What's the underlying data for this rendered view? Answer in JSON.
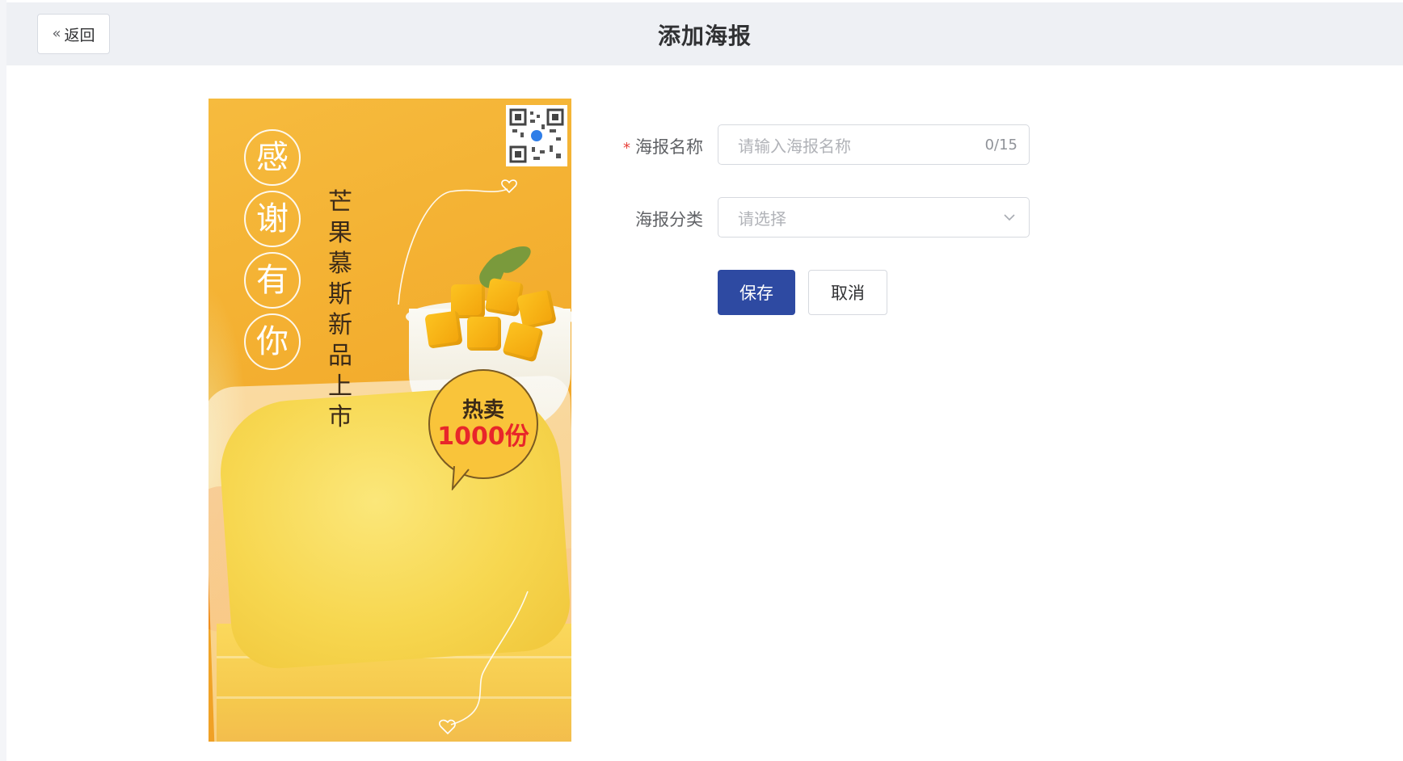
{
  "header": {
    "back_label": "返回",
    "back_icon": "double-chevron-left-icon",
    "title": "添加海报"
  },
  "poster": {
    "circle_chars": [
      "感",
      "谢",
      "有",
      "你"
    ],
    "slogan": "芒果慕斯新品上市",
    "badge_line1": "热卖",
    "badge_line2": "1000份",
    "qr_icon": "qr-code-icon",
    "colors": {
      "background": "#f3ae2f",
      "badge": "#f9c43a",
      "badge_accent": "#e8262a"
    }
  },
  "form": {
    "name_label": "海报名称",
    "name_required_mark": "*",
    "name_placeholder": "请输入海报名称",
    "name_counter": "0/15",
    "category_label": "海报分类",
    "category_placeholder": "请选择",
    "category_icon": "chevron-down-icon",
    "save_label": "保存",
    "cancel_label": "取消"
  },
  "colors": {
    "primary": "#2e4aa2",
    "required": "#e8413a",
    "header_bg": "#eef0f4"
  }
}
